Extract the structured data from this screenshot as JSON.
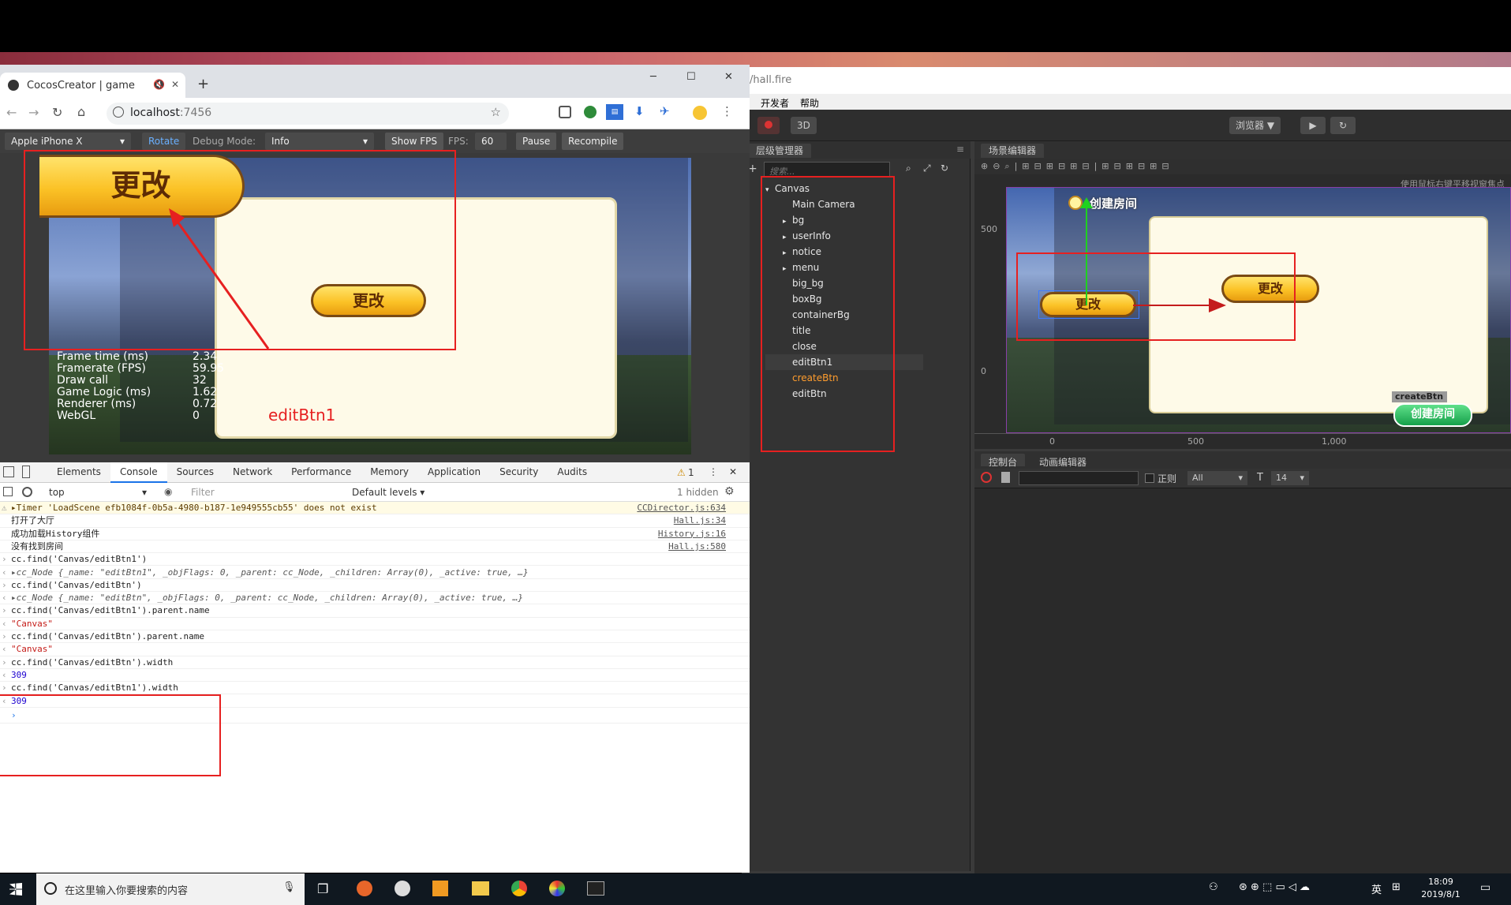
{
  "browser": {
    "tab_title": "CocosCreator | game",
    "url_host": "localhost",
    "url_port": ":7456",
    "win_min": "─",
    "win_max": "☐",
    "win_close": "✕"
  },
  "cocos_toolbar": {
    "device": "Apple iPhone X",
    "rotate": "Rotate",
    "debug_mode_label": "Debug Mode:",
    "debug_mode_value": "Info",
    "show_fps": "Show FPS",
    "fps_label": "FPS:",
    "fps_value": "60",
    "pause": "Pause",
    "recompile": "Recompile"
  },
  "game": {
    "big_button": "更改",
    "dialog_button": "更改",
    "fps_lines": [
      {
        "label": "Frame time (ms)",
        "value": "2.34"
      },
      {
        "label": "Framerate (FPS)",
        "value": "59.95"
      },
      {
        "label": "Draw call",
        "value": "32"
      },
      {
        "label": "Game Logic (ms)",
        "value": "1.62"
      },
      {
        "label": "Renderer (ms)",
        "value": "0.72"
      },
      {
        "label": "WebGL",
        "value": "0"
      }
    ],
    "annotation": "editBtn1"
  },
  "devtools": {
    "tabs": [
      "Elements",
      "Console",
      "Sources",
      "Network",
      "Performance",
      "Memory",
      "Application",
      "Security",
      "Audits"
    ],
    "active_tab": "Console",
    "warn_count": "1",
    "context": "top",
    "filter_placeholder": "Filter",
    "levels": "Default levels ▾",
    "hidden": "1 hidden",
    "logs": [
      {
        "kind": "warn",
        "text": "▸Timer 'LoadScene efb1084f-0b5a-4980-b187-1e949555cb55' does not exist",
        "src": "CCDirector.js:634"
      },
      {
        "kind": "log",
        "text": "打开了大厅",
        "src": "Hall.js:34"
      },
      {
        "kind": "log",
        "text": "成功加载History组件",
        "src": "History.js:16"
      },
      {
        "kind": "log",
        "text": "没有找到房间",
        "src": "Hall.js:580"
      },
      {
        "kind": "cmd",
        "text": "cc.find('Canvas/editBtn1')",
        "src": ""
      },
      {
        "kind": "res",
        "text": "▸cc_Node {_name: \"editBtn1\", _objFlags: 0, _parent: cc_Node, _children: Array(0), _active: true, …}",
        "src": ""
      },
      {
        "kind": "cmd",
        "text": "cc.find('Canvas/editBtn')",
        "src": ""
      },
      {
        "kind": "res",
        "text": "▸cc_Node {_name: \"editBtn\", _objFlags: 0, _parent: cc_Node, _children: Array(0), _active: true, …}",
        "src": ""
      },
      {
        "kind": "cmd",
        "text": "cc.find('Canvas/editBtn1').parent.name",
        "src": ""
      },
      {
        "kind": "str",
        "text": "\"Canvas\"",
        "src": ""
      },
      {
        "kind": "cmd",
        "text": "cc.find('Canvas/editBtn').parent.name",
        "src": ""
      },
      {
        "kind": "str",
        "text": "\"Canvas\"",
        "src": ""
      },
      {
        "kind": "cmd",
        "text": "cc.find('Canvas/editBtn').width",
        "src": ""
      },
      {
        "kind": "num",
        "text": "309",
        "src": ""
      },
      {
        "kind": "cmd",
        "text": "cc.find('Canvas/editBtn1').width",
        "src": ""
      },
      {
        "kind": "num",
        "text": "309",
        "src": ""
      }
    ],
    "prompt": "›"
  },
  "editor": {
    "path": "/hall.fire",
    "menu": [
      "开发者",
      "帮助"
    ],
    "btn_3d": "3D",
    "browser_btn": "浏览器 ▼",
    "hierarchy_title": "层级管理器",
    "search_placeholder": "搜索...",
    "nodes": [
      {
        "name": "Canvas",
        "arrow": "▾",
        "indent": 0
      },
      {
        "name": "Main Camera",
        "arrow": "",
        "indent": 1
      },
      {
        "name": "bg",
        "arrow": "▸",
        "indent": 1
      },
      {
        "name": "userInfo",
        "arrow": "▸",
        "indent": 1
      },
      {
        "name": "notice",
        "arrow": "▸",
        "indent": 1
      },
      {
        "name": "menu",
        "arrow": "▸",
        "indent": 1
      },
      {
        "name": "big_bg",
        "arrow": "",
        "indent": 1
      },
      {
        "name": "boxBg",
        "arrow": "",
        "indent": 1
      },
      {
        "name": "containerBg",
        "arrow": "",
        "indent": 1
      },
      {
        "name": "title",
        "arrow": "",
        "indent": 1
      },
      {
        "name": "close",
        "arrow": "",
        "indent": 1
      },
      {
        "name": "editBtn1",
        "arrow": "",
        "indent": 1
      },
      {
        "name": "createBtn",
        "arrow": "",
        "indent": 1
      },
      {
        "name": "editBtn",
        "arrow": "",
        "indent": 1
      }
    ],
    "selected_node": "createBtn",
    "scene_title": "场景编辑器",
    "scene_hint": "使用鼠标右键平移视窗焦点",
    "scene_header": "创建房间",
    "scene_btn_left": "更改",
    "scene_btn_right": "更改",
    "create_btn_label": "createBtn",
    "create_btn_text": "创建房间",
    "ruler_y_500": "500",
    "ruler_y_0": "0",
    "ruler_x_0": "0",
    "ruler_x_500": "500",
    "ruler_x_1000": "1,000",
    "console_tab": "控制台",
    "anim_tab": "动画编辑器",
    "regex_label": "正则",
    "level_select": "All",
    "font_size": "14"
  },
  "taskbar": {
    "search_placeholder": "在这里输入你要搜索的内容",
    "time": "18:09",
    "date": "2019/8/1",
    "ime": "英"
  }
}
